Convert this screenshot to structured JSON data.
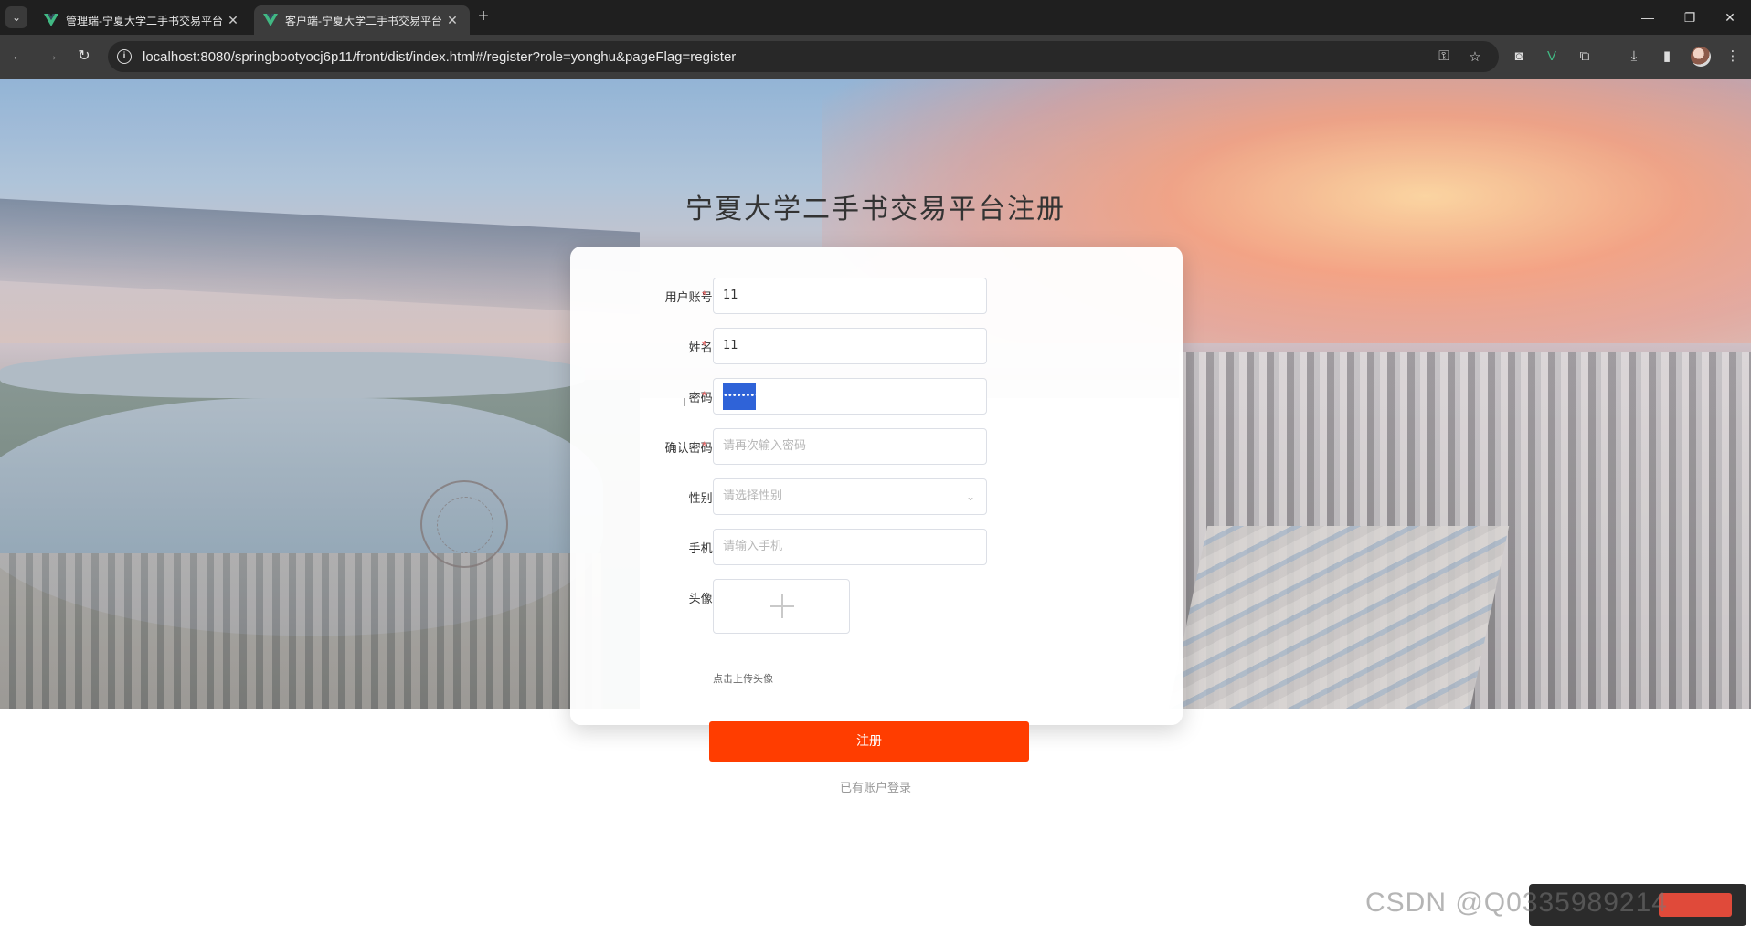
{
  "browser": {
    "tabs": [
      {
        "title": "管理端-宁夏大学二手书交易平台",
        "active": false
      },
      {
        "title": "客户端-宁夏大学二手书交易平台",
        "active": true
      }
    ],
    "url": "localhost:8080/springbootyocj6p11/front/dist/index.html#/register?role=yonghu&pageFlag=register"
  },
  "page": {
    "title": "宁夏大学二手书交易平台注册",
    "form": {
      "username": {
        "label": "用户账号:",
        "value": "11"
      },
      "name": {
        "label": "姓名:",
        "value": "11"
      },
      "password": {
        "label": "密码:",
        "value": "••••••••"
      },
      "confirm_password": {
        "label": "确认密码:",
        "placeholder": "请再次输入密码"
      },
      "gender": {
        "label": "性别:",
        "placeholder": "请选择性别"
      },
      "phone": {
        "label": "手机:",
        "placeholder": "请输入手机"
      },
      "avatar": {
        "label": "头像:",
        "hint": "点击上传头像"
      },
      "required_mark": "*"
    },
    "submit_label": "注册",
    "login_link": "已有账户登录"
  },
  "watermark": {
    "text": "CSDN @Q0335989214"
  },
  "colors": {
    "accent": "#ff3d00",
    "required": "#f56c6c",
    "selection": "#2f63d8"
  }
}
